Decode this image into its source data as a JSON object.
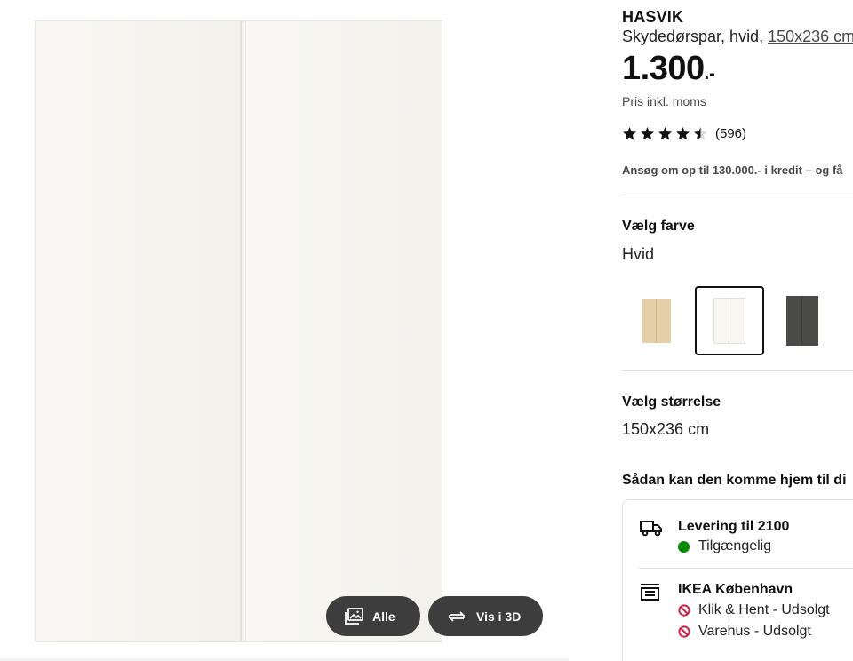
{
  "product": {
    "brand": "HASVIK",
    "subtitle_text": "Skydedørspar, hvid, ",
    "subtitle_size": "150x236 cm",
    "price_int": "1.300",
    "price_suffix": ".-",
    "vat_note": "Pris inkl. moms",
    "rating_value": 4.5,
    "rating_count": "(596)",
    "credit_text": "Ansøg om op til 130.000.- i kredit – og få"
  },
  "gallery": {
    "all_label": "Alle",
    "view3d_label": "Vis i 3D"
  },
  "color": {
    "heading": "Vælg farve",
    "selected": "Hvid",
    "swatches": [
      {
        "name": "white-stained-oak",
        "color": "#e3cfa8"
      },
      {
        "name": "white",
        "color": "#f7f6f1"
      },
      {
        "name": "dark-grey",
        "color": "#4a4a48"
      }
    ]
  },
  "size": {
    "heading": "Vælg størrelse",
    "selected": "150x236 cm"
  },
  "delivery": {
    "heading": "Sådan kan den komme hjem til di",
    "home_delivery_title": "Levering til 2100",
    "home_delivery_status": "Tilgængelig",
    "store_title": "IKEA København",
    "store_click_collect": "Klik & Hent - Udsolgt",
    "store_warehouse": "Varehus - Udsolgt"
  },
  "colors": {
    "available": "#0a8a00",
    "unavailable": "#c8254b",
    "pill_bg": "#3d3d3d"
  }
}
